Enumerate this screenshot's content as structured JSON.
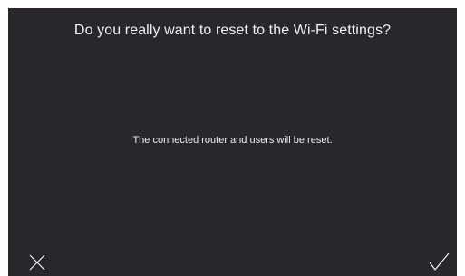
{
  "dialog": {
    "title": "Do you really want to reset to the Wi-Fi settings?",
    "message": "The connected router and users will be reset."
  },
  "actions": {
    "cancel_icon": "close-icon",
    "confirm_icon": "checkmark-icon"
  },
  "colors": {
    "background": "#29272b",
    "text": "#ffffff"
  }
}
